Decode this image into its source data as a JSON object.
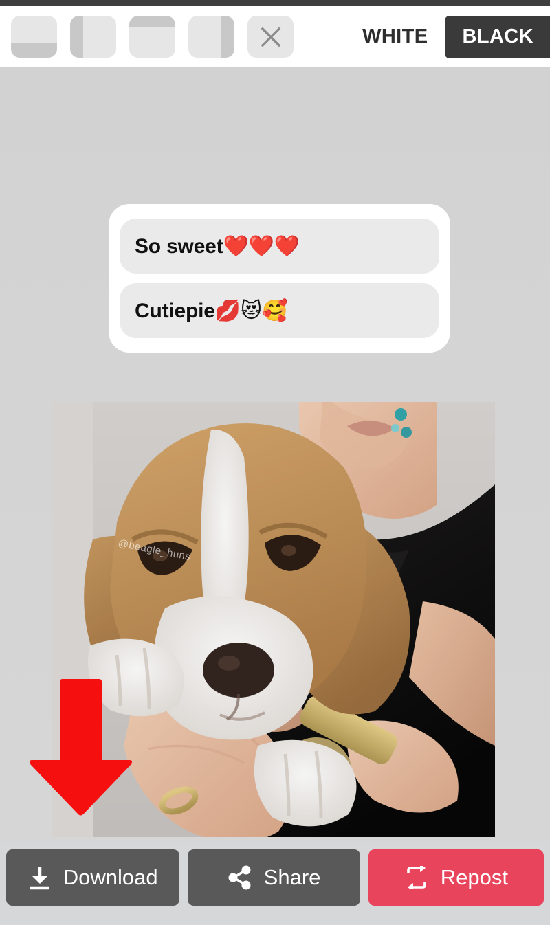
{
  "app": {
    "background_color": "#d4d4d4",
    "toolbar_background": "#ffffff",
    "status_strip_color": "#3f3e3e"
  },
  "toolbar": {
    "crop_tools": [
      {
        "name": "crop-bottom-bar",
        "icon": "crop-bottom-icon",
        "accent_position": "bottom"
      },
      {
        "name": "crop-left-bar",
        "icon": "crop-left-icon",
        "accent_position": "left"
      },
      {
        "name": "crop-top-bar",
        "icon": "crop-top-icon",
        "accent_position": "top"
      },
      {
        "name": "crop-right-bar",
        "icon": "crop-right-icon",
        "accent_position": "right"
      },
      {
        "name": "crop-clear",
        "icon": "close-x-icon",
        "accent_position": "none"
      }
    ],
    "mode_toggle": {
      "options": [
        {
          "label": "WHITE",
          "selected": false
        },
        {
          "label": "BLACK",
          "selected": true
        }
      ],
      "selected_label": "BLACK",
      "selected_background": "#3b3a3a",
      "selected_text_color": "#ffffff",
      "unselected_text_color": "#2e2e2e"
    }
  },
  "canvas": {
    "comment_card": {
      "background": "#ffffff",
      "bubble_background": "#eaeaea",
      "comments": [
        {
          "text": "So sweet",
          "emoji": "❤️❤️❤️"
        },
        {
          "text": "Cutiepie",
          "emoji": "💋😻🥰"
        }
      ]
    },
    "photo": {
      "description": "beagle puppy held in a person's hands",
      "watermark": "@beagle_huns"
    },
    "annotation": {
      "type": "arrow-down",
      "color": "#f50f0f",
      "points_to": "download-button"
    }
  },
  "action_bar": {
    "background": "#d5d7d9",
    "buttons": [
      {
        "label": "Download",
        "icon": "download-icon",
        "background": "#595959",
        "text_color": "#ffffff"
      },
      {
        "label": "Share",
        "icon": "share-icon",
        "background": "#595959",
        "text_color": "#ffffff"
      },
      {
        "label": "Repost",
        "icon": "repost-icon",
        "background": "#e8455c",
        "text_color": "#ffffff"
      }
    ]
  }
}
